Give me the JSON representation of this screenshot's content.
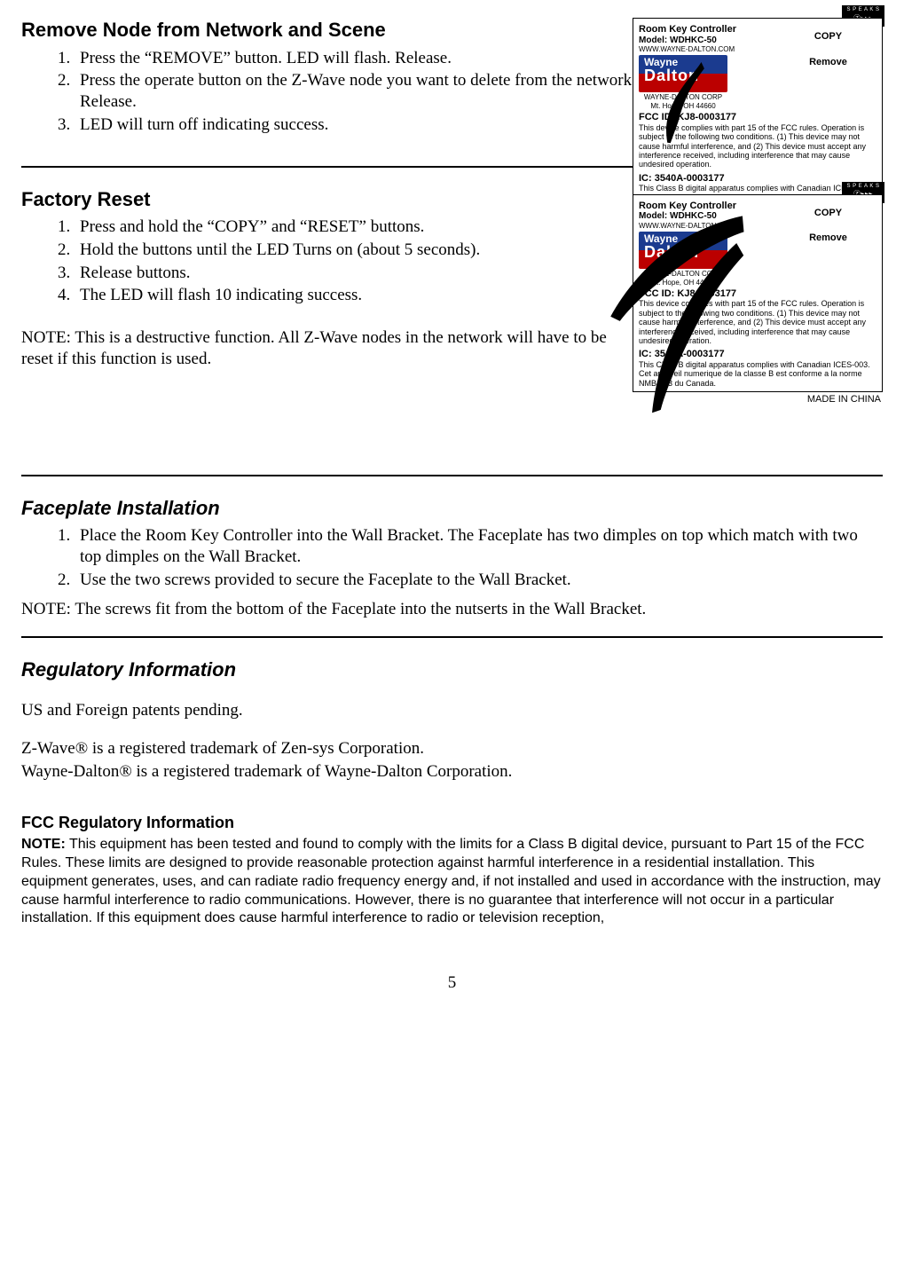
{
  "sections": {
    "remove": {
      "heading": "Remove Node from Network and Scene",
      "steps": [
        "Press the “REMOVE” button. LED will flash. Release.",
        "Press the operate button on the Z-Wave node you want to delete from the network. Release.",
        "LED will turn off indicating success."
      ]
    },
    "reset": {
      "heading": "Factory Reset",
      "steps": [
        "Press and hold the “COPY” and “RESET” buttons.",
        "Hold the buttons until the LED Turns on (about 5 seconds).",
        "Release buttons.",
        "The LED will flash 10 indicating success."
      ],
      "note": "NOTE:  This is a destructive function.  All Z-Wave nodes in the network will have to be reset if this function is used."
    },
    "faceplate": {
      "heading": "Faceplate Installation",
      "steps": [
        "Place the Room Key Controller into the Wall Bracket.  The Faceplate has two dimples on top which match with two top dimples on the Wall Bracket.",
        "Use the two screws provided to secure the Faceplate to the Wall Bracket."
      ],
      "note": "NOTE:  The screws fit from the bottom of the Faceplate into the nutserts in the Wall Bracket."
    },
    "regulatory": {
      "heading": "Regulatory Information",
      "patents": "US and Foreign patents pending.",
      "trademark1": "Z-Wave® is a registered trademark of Zen-sys Corporation.",
      "trademark2": "Wayne-Dalton® is a registered trademark of Wayne-Dalton Corporation.",
      "fcc_heading": "FCC Regulatory Information",
      "fcc_note_label": "NOTE:",
      "fcc_note": " This equipment has been tested and found to comply with the limits for a Class B digital device, pursuant to Part 15 of the FCC Rules.  These limits are designed to provide reasonable protection against harmful interference in a residential installation.  This equipment generates, uses, and can radiate radio frequency energy and, if not installed and used in accordance with the instruction, may cause harmful interference to radio communications.  However, there is no guarantee that interference will not occur in a particular installation.  If this equipment does cause harmful interference to radio or television reception,"
    }
  },
  "device_label": {
    "speaks_top": "S P E A K S",
    "speaks_icon": "Ⓩ▸▸▸",
    "product_title": "Room Key Controller",
    "model_label": "Model:",
    "model_value": "WDHKC-50",
    "website": "WWW.WAYNE-DALTON.COM",
    "copy_btn": "COPY",
    "remove_btn": "Remove",
    "logo_top": "Wayne",
    "logo_bottom": "Dalton",
    "corp_name": "WAYNE-DALTON CORP",
    "corp_addr": "Mt. Hope, OH 44660",
    "fcc_id_label": "FCC ID: KJ8-0003177",
    "fcc_text": "This device complies with part 15 of the FCC rules. Operation is subject to the following two conditions. (1) This device may not cause harmful interference, and (2) This device must accept any interference received, including interference that may cause undesired operation.",
    "ic_id_label": "IC: 3540A-0003177",
    "ic_text": "This Class B digital apparatus complies with Canadian ICES-003. Cet appareil numerique de la classe B est conforme a la norme NMB-003 du Canada.",
    "made_in": "MADE IN CHINA"
  },
  "page_number": "5"
}
